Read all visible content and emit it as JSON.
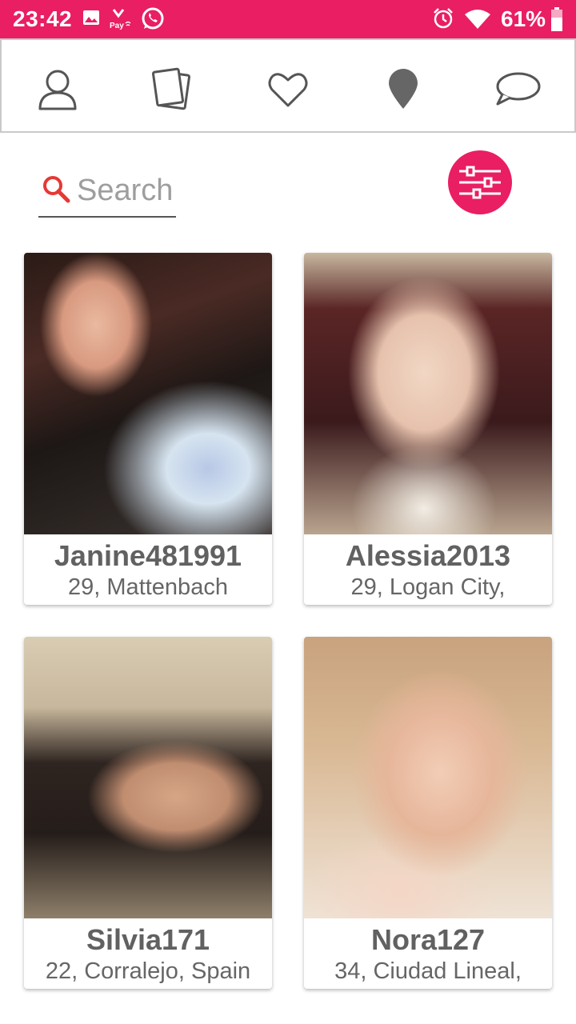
{
  "status_bar": {
    "time": "23:42",
    "battery": "61%",
    "icons": [
      "image-icon",
      "pay-icon",
      "whatsapp-icon",
      "alarm-icon",
      "wifi-icon",
      "battery-icon"
    ]
  },
  "nav": {
    "items": [
      {
        "name": "profile",
        "icon": "person-icon"
      },
      {
        "name": "cards",
        "icon": "cards-icon"
      },
      {
        "name": "favorites",
        "icon": "heart-icon"
      },
      {
        "name": "nearby",
        "icon": "location-pin-icon"
      },
      {
        "name": "messages",
        "icon": "chat-bubble-icon"
      }
    ]
  },
  "search": {
    "placeholder": "Search",
    "value": ""
  },
  "colors": {
    "accent": "#e91e63",
    "name_text": "#616161",
    "info_text": "#666666"
  },
  "profiles": [
    {
      "name": "Janine481991",
      "info": "29, Mattenbach"
    },
    {
      "name": "Alessia2013",
      "info": "29, Logan City,"
    },
    {
      "name": "Silvia171",
      "info": "22, Corralejo, Spain"
    },
    {
      "name": "Nora127",
      "info": "34, Ciudad Lineal,"
    }
  ]
}
